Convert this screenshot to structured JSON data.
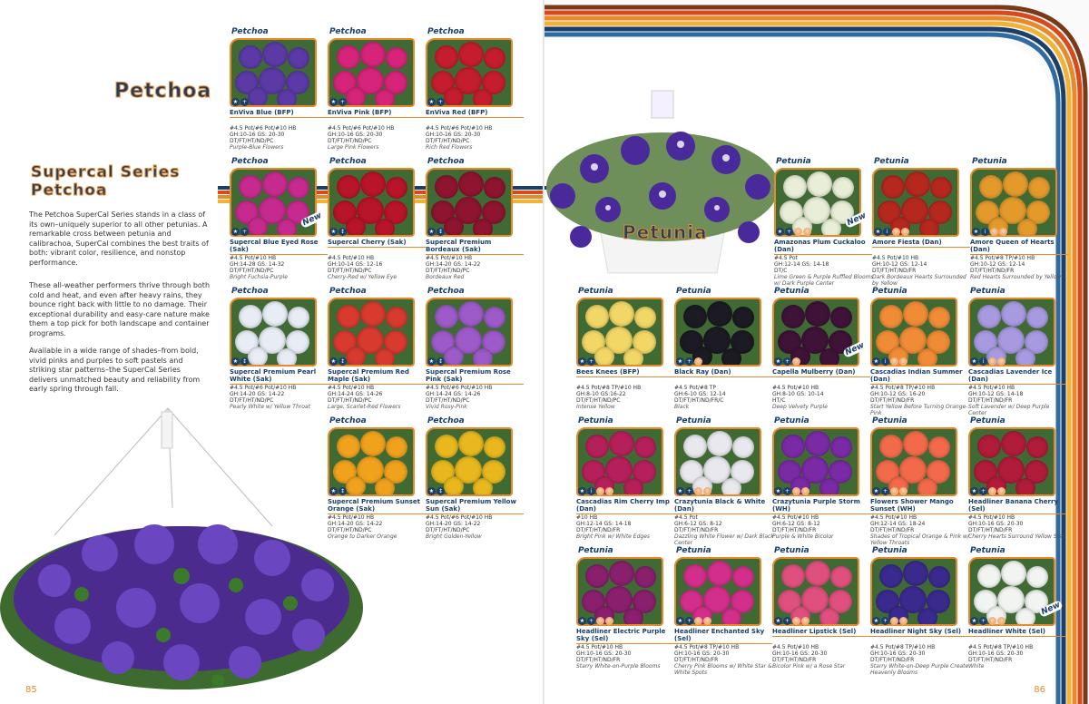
{
  "left_page": {
    "brand_logo": "Petchoa",
    "section_title": "Supercal Series",
    "section_subtitle": "Petchoa",
    "paragraphs": [
      "The Petchoa SuperCal Series stands in a class of its own–uniquely superior to all other petunias. A remarkable cross between petunia and calibrachoa, SuperCal combines the best traits of both: vibrant color, resilience, and nonstop performance.",
      "These all-weather performers thrive through both cold and heat, and even after heavy rains, they bounce right back with little to no damage. Their exceptional durability and easy-care nature make them a top pick for both landscape and container programs.",
      "Available in a wide range of shades–from bold, vivid pinks and purples to soft pastels and striking star patterns–the SuperCal Series delivers unmatched beauty and reliability from early spring through fall."
    ],
    "page_number": "85",
    "cards": [
      {
        "tag": "Petchoa",
        "name": "EnViva Blue (BFP)",
        "spec": "#4.5 Pot/#6 Pot/#10 HB\nGH:10-16 GS: 20-30\nDT/FT/HT/ND/PC",
        "desc": "Purple-Blue Flowers",
        "color": "#5b3aa6",
        "icons": [
          "★",
          "+"
        ],
        "new": false
      },
      {
        "tag": "Petchoa",
        "name": "EnViva Pink (BFP)",
        "spec": "#4.5 Pot/#6 Pot/#10 HB\nGH:10-16 GS: 20-30\nDT/FT/HT/ND/PC",
        "desc": "Large Pink Flowers",
        "color": "#d6247a",
        "icons": [
          "★",
          "+"
        ],
        "new": false
      },
      {
        "tag": "Petchoa",
        "name": "EnViva Red (BFP)",
        "spec": "#4.5 Pot/#6 Pot/#10 HB\nGH:10-16 GS: 20-30\nDT/FT/HT/ND/PC",
        "desc": "Rich Red Flowers",
        "color": "#c41d2e",
        "icons": [
          "★",
          "+"
        ],
        "new": false
      },
      {
        "tag": "Petchoa",
        "name": "Supercal Blue Eyed Rose (Sak)",
        "spec": "#4.5 Pot/#10 HB\nGH:14-28 GS: 14-32\nDT/FT/HT/ND/PC",
        "desc": "Bright Fuchsia-Purple",
        "color": "#c72a8e",
        "icons": [
          "★",
          "+"
        ],
        "new": true
      },
      {
        "tag": "Petchoa",
        "name": "Supercal Cherry (Sak)",
        "spec": "#4.5 Pot/#10 HB\nGH:10-14 GS: 12-16\nDT/FT/HT/ND/PC",
        "desc": "Cherry-Red w/ Yellow Eye",
        "color": "#b8142a",
        "icons": [
          "★",
          "↕"
        ],
        "new": false
      },
      {
        "tag": "Petchoa",
        "name": "Supercal Premium Bordeaux (Sak)",
        "spec": "#4.5 Pot/#10 HB\nGH:14-20 GS: 14-22\nDT/FT/HT/ND/PC",
        "desc": "Bordeaux Red",
        "color": "#8e1430",
        "icons": [
          "★",
          "↕"
        ],
        "new": false
      },
      {
        "tag": "Petchoa",
        "name": "Supercal Premium Pearl White (Sak)",
        "spec": "#4.5 Pot/#6 Pot/#10 HB\nGH:14-20 GS: 14-22\nDT/FT/HT/ND/PC",
        "desc": "Pearly White w/ Yellow Throat",
        "color": "#e8ecf5",
        "icons": [
          "★",
          "↕"
        ],
        "new": false
      },
      {
        "tag": "Petchoa",
        "name": "Supercal Premium Red Maple (Sak)",
        "spec": "#4.5 Pot/#10 HB\nGH:14-24 GS: 14-26\nDT/FT/HT/ND/PC",
        "desc": "Large, Scarlet-Red Flowers",
        "color": "#d83a2e",
        "icons": [
          "★",
          "↕"
        ],
        "new": false
      },
      {
        "tag": "Petchoa",
        "name": "Supercal Premium Rose Pink (Sak)",
        "spec": "#4.5 Pot/#6 Pot/#10 HB\nGH:14-24 GS: 14-26\nDT/FT/HT/ND/PC",
        "desc": "Vivid Rosy-Pink",
        "color": "#9d5ac9",
        "icons": [
          "★",
          "↕"
        ],
        "new": false
      },
      {
        "tag": "Petchoa",
        "name": "Supercal Premium Sunset Orange (Sak)",
        "spec": "#4.5 Pot/#10 HB\nGH:14-20 GS: 14-22\nDT/FT/HT/ND/PC",
        "desc": "Orange to Darker Orange",
        "color": "#f0a21d",
        "icons": [
          "★",
          "↕"
        ],
        "new": false
      },
      {
        "tag": "Petchoa",
        "name": "Supercal Premium Yellow Sun (Sak)",
        "spec": "#4.5 Pot/#6 Pot/#10 HB\nGH:14-20 GS: 14-22\nDT/FT/HT/ND/PC",
        "desc": "Bright Golden-Yellow",
        "color": "#e8b81e",
        "icons": [
          "★",
          "↕"
        ],
        "new": false
      }
    ]
  },
  "right_page": {
    "section_logo": "Petunia",
    "page_number": "86",
    "cards": [
      {
        "tag": "Petunia",
        "name": "Amazonas Plum Cuckaloo (Dan)",
        "spec": "#4.5 Pot\nGH:12-14 GS: 14-18\nDT/C",
        "desc": "Lime Green & Purple Ruffled Blooms w/ Dark Purple Center",
        "color": "#e9eed8",
        "icons": [
          "★",
          "+",
          "☼",
          "☼"
        ],
        "new": true
      },
      {
        "tag": "Petunia",
        "name": "Amore Fiesta (Dan)",
        "spec": "#4.5 Pot/#10 HB\nGH:10-12 GS: 12-14\nDT/FT/HT/ND/FR",
        "desc": "Dark Bordeaux Hearts Surrounded by Yellow",
        "color": "#b5281e",
        "icons": [
          "★",
          "i",
          "☼",
          "☼"
        ],
        "new": false
      },
      {
        "tag": "Petunia",
        "name": "Amore Queen of Hearts (Dan)",
        "spec": "#4.5 Pot/#8 TP/#10 HB\nGH:10-12 GS: 12-14\nDT/FT/HT/ND/FR",
        "desc": "Red Hearts Surrounded by Yellow",
        "color": "#e39a2b",
        "icons": [
          "★",
          "i",
          "☼",
          "☼"
        ],
        "new": false
      },
      {
        "tag": "Petunia",
        "name": "Bees Knees (BFP)",
        "spec": "#4.5 Pot/#8 TP/#10 HB\nGH:8-10 GS:16-22\nDT/FT/HT/ND/PC",
        "desc": "Intense Yellow",
        "color": "#f2d766",
        "icons": [
          "★",
          "+"
        ],
        "new": false
      },
      {
        "tag": "Petunia",
        "name": "Black Ray (Dan)",
        "spec": "#4.5 Pot/#8 TP\nGH:6-10 GS: 12-14\nDT/FT/HT/ND/FR/C",
        "desc": "Black",
        "color": "#1c1a22",
        "icons": [
          "★",
          "+",
          "☼"
        ],
        "new": false
      },
      {
        "tag": "Petunia",
        "name": "Capella Mulberry (Dan)",
        "spec": "#4.5 Pot/#10 HB\nGH:8-10 GS: 10-14\nHT/C",
        "desc": "Deep Velvety Purple",
        "color": "#3f1238",
        "icons": [
          "★",
          "+",
          "☼"
        ],
        "new": true
      },
      {
        "tag": "Petunia",
        "name": "Cascadias Indian Summer (Dan)",
        "spec": "#4.5 Pot/#8 TP/#10 HB\nGH:10-12 GS: 16-20\nDT/FT/HT/ND/FR",
        "desc": "Start Yellow Before Turning Orange-Pink",
        "color": "#f08c35",
        "icons": [
          "★",
          "i",
          "☼",
          "☼"
        ],
        "new": false
      },
      {
        "tag": "Petunia",
        "name": "Cascadias Lavender Ice (Dan)",
        "spec": "#4.5 Pot/#10 HB\nGH:10-12 GS: 14-18\nDT/FT/HT/ND/FR",
        "desc": "Soft Lavender w/ Deep Purple Center",
        "color": "#a89ae0",
        "icons": [
          "★",
          "i",
          "☼",
          "☼"
        ],
        "new": false
      },
      {
        "tag": "Petunia",
        "name": "Cascadias Rim Cherry Imp (Dan)",
        "spec": "#10 HB\nGH:12-14 GS: 14-18\nDT/FT/HT/ND/FR",
        "desc": "Bright Pink w/ White Edges",
        "color": "#b5205a",
        "icons": [
          "★",
          "i",
          "☼",
          "☼"
        ],
        "new": false
      },
      {
        "tag": "Petunia",
        "name": "Crazytunia Black & White (Dan)",
        "spec": "#4.5 Pot\nGH:6-12 GS: 8-12\nDT/FT/HT/ND/FR",
        "desc": "Dazzling White Flower w/ Dark Black Center",
        "color": "#e8e8ee",
        "icons": [
          "★",
          "+",
          "☼",
          "☼"
        ],
        "new": false
      },
      {
        "tag": "Petunia",
        "name": "Crazytunia Purple Storm (WH)",
        "spec": "#4.5 Pot/#10 HB\nGH:6-12 GS: 8-12\nDT/FT/HT/ND/FR",
        "desc": "Purple & White Bicolor",
        "color": "#7a2aa5",
        "icons": [
          "★",
          "+",
          "☼",
          "☼"
        ],
        "new": false
      },
      {
        "tag": "Petunia",
        "name": "Flowers Shower Mango Sunset (WH)",
        "spec": "#4.5 Pot/#10 HB\nGH:12-14 GS: 18-24\nDT/FT/HT/ND/FR",
        "desc": "Shades of Tropical Orange & Pink w/ Yellow Throats",
        "color": "#f36a4a",
        "icons": [
          "★",
          "+",
          "☼",
          "☼"
        ],
        "new": false
      },
      {
        "tag": "Petunia",
        "name": "Headliner Banana Cherry (Sel)",
        "spec": "#4.5 Pot/#10 HB\nGH:10-16 GS: 20-30\nDT/FT/HT/ND/FR",
        "desc": "Cherry Hearts Surround Yellow Star",
        "color": "#b01c3a",
        "icons": [
          "★",
          "+",
          "☼",
          "☼"
        ],
        "new": false
      },
      {
        "tag": "Petunia",
        "name": "Headliner Electric Purple Sky (Sel)",
        "spec": "#4.5 Pot/#10 HB\nGH:10-16 GS: 20-30\nDT/FT/HT/ND/FR",
        "desc": "Starry White-on-Purple Blooms",
        "color": "#8a1f6e",
        "icons": [
          "★",
          "+",
          "☼",
          "☼"
        ],
        "new": false
      },
      {
        "tag": "Petunia",
        "name": "Headliner Enchanted Sky (Sel)",
        "spec": "#4.5 Pot/#8 TP/#10 HB\nGH:10-16 GS: 20-30\nDT/FT/HT/ND/FR",
        "desc": "Cherry Pink Blooms w/ White Star & White Spots",
        "color": "#d42e8c",
        "icons": [
          "★",
          "+",
          "☼",
          "☼"
        ],
        "new": false
      },
      {
        "tag": "Petunia",
        "name": "Headliner Lipstick (Sel)",
        "spec": "#4.5 Pot/#10 HB\nGH:10-16 GS: 20-30\nDT/FT/HT/ND/FR",
        "desc": "Bicolor Pink w/ a Rose Star",
        "color": "#e0507e",
        "icons": [
          "★",
          "+",
          "☼",
          "☼"
        ],
        "new": false
      },
      {
        "tag": "Petunia",
        "name": "Headliner Night Sky (Sel)",
        "spec": "#4.5 Pot/#8 TP/#10 HB\nGH:10-16 GS: 20-30\nDT/FT/HT/ND/FR",
        "desc": "Starry White-on-Deep Purple Create Heavenly Blooms",
        "color": "#3b2a8e",
        "icons": [
          "★",
          "+",
          "☼",
          "☼"
        ],
        "new": false
      },
      {
        "tag": "Petunia",
        "name": "Headliner White (Sel)",
        "spec": "#4.5 Pot/#8 TP/#10 HB\nGH:10-16 GS: 20-30\nDT/FT/HT/ND/FR",
        "desc": "White",
        "color": "#f2f4f2",
        "icons": [
          "★",
          "+",
          "☼",
          "☼"
        ],
        "new": true
      }
    ]
  },
  "new_badge_label": "New",
  "colors": {
    "navy": "#1b3f6b",
    "orange": "#e8892b",
    "stripe1": "#1b3f6b",
    "stripe2": "#d84a1b",
    "stripe3": "#e8892b",
    "stripe4": "#f2b236",
    "stripe5": "#7a3a1a"
  }
}
